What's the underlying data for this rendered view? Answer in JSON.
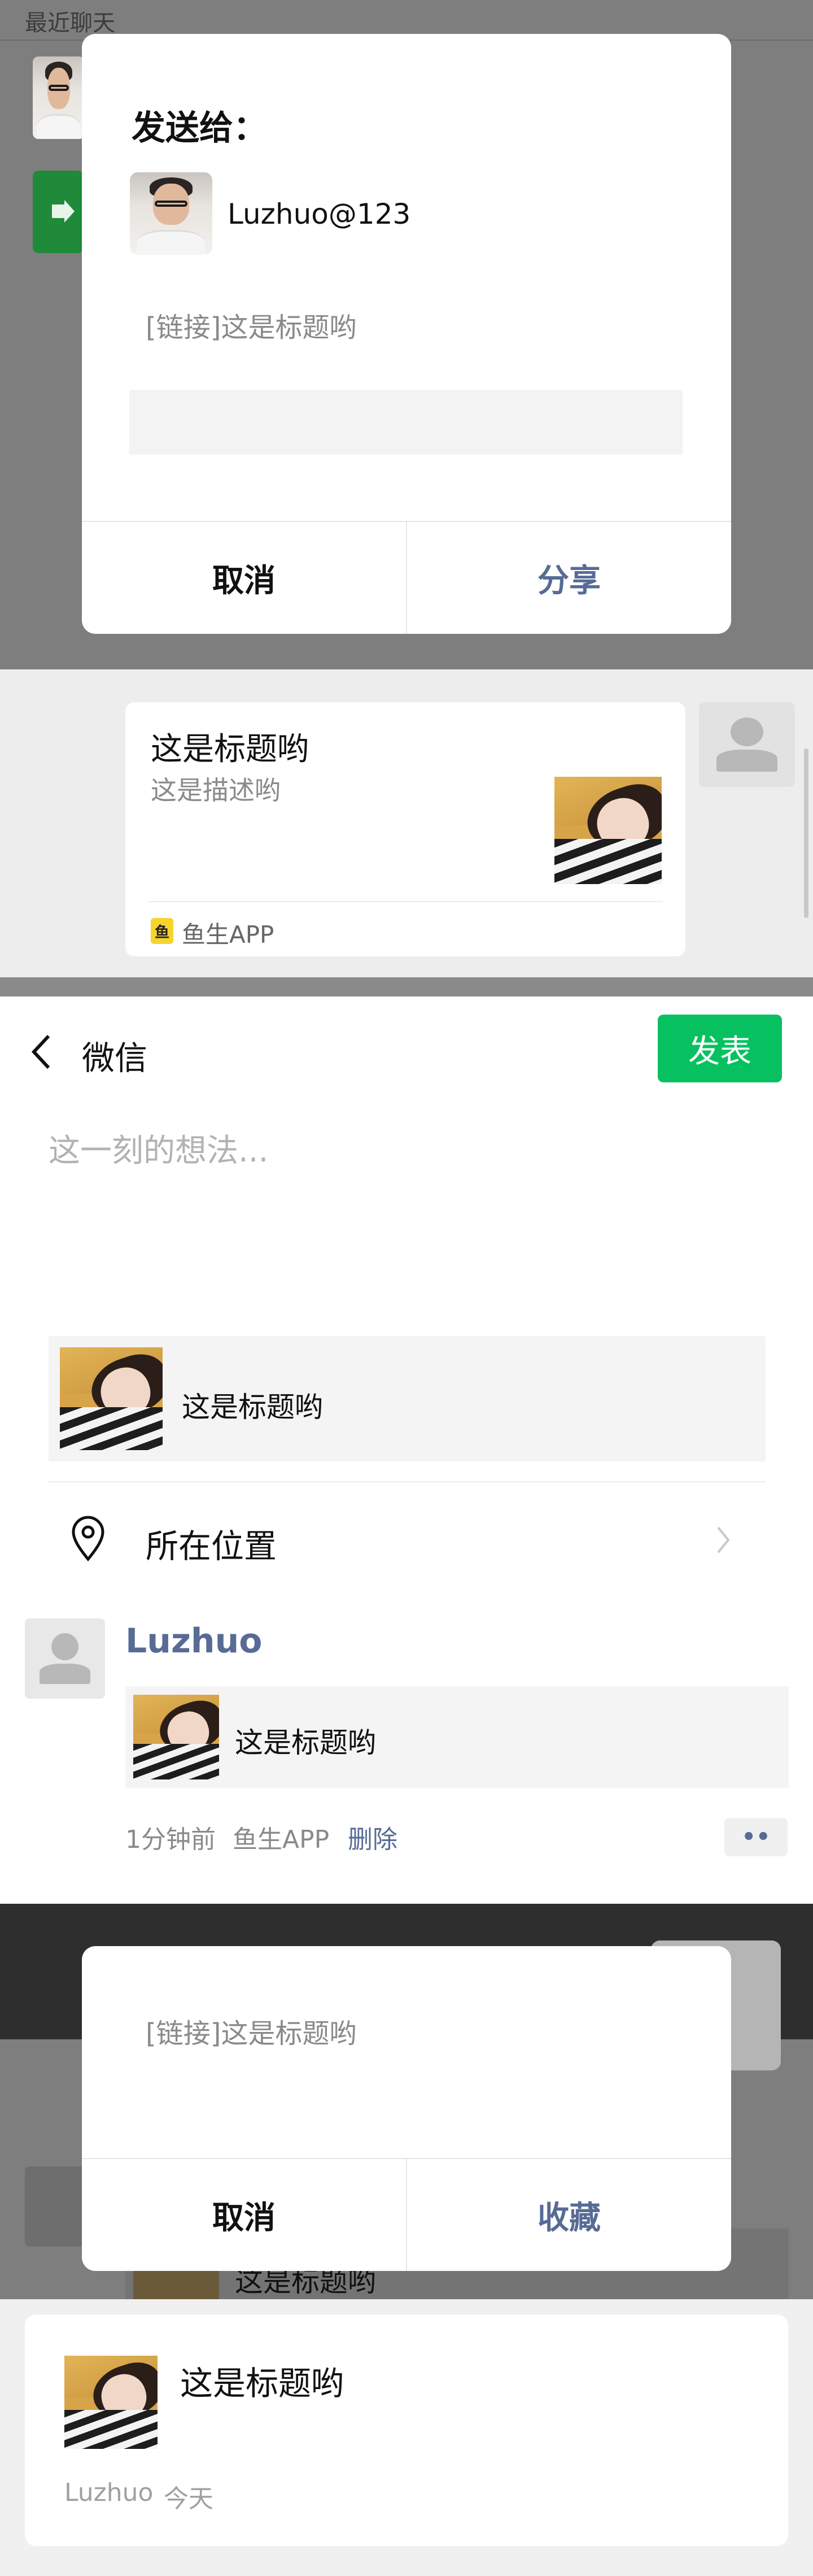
{
  "share_dialog": {
    "recent_label": "最近聊天",
    "title": "发送给：",
    "recipient_name": "Luzhuo@123",
    "link_text": "[链接]这是标题哟",
    "cancel_label": "取消",
    "share_label": "分享"
  },
  "chat_message": {
    "title": "这是标题哟",
    "description": "这是描述哟",
    "app_name": "鱼生APP"
  },
  "moments_compose": {
    "back_label": "微信",
    "publish_label": "发表",
    "placeholder": "这一刻的想法...",
    "link_title": "这是标题哟",
    "location_label": "所在位置"
  },
  "moments_post": {
    "user_name": "Luzhuo",
    "link_title": "这是标题哟",
    "time": "1分钟前",
    "app_name": "鱼生APP",
    "delete_label": "删除",
    "more_label": "••"
  },
  "favorite_dialog": {
    "link_text": "[链接]这是标题哟",
    "cancel_label": "取消",
    "favorite_label": "收藏"
  },
  "favorite_item": {
    "behind_title": "这是标题哟",
    "title": "这是标题哟",
    "source": "Luzhuo",
    "date": "今天"
  },
  "colors": {
    "wechat_green": "#07c160",
    "link_blue": "#576b95",
    "overlay_gray": "#7e7e7e"
  }
}
